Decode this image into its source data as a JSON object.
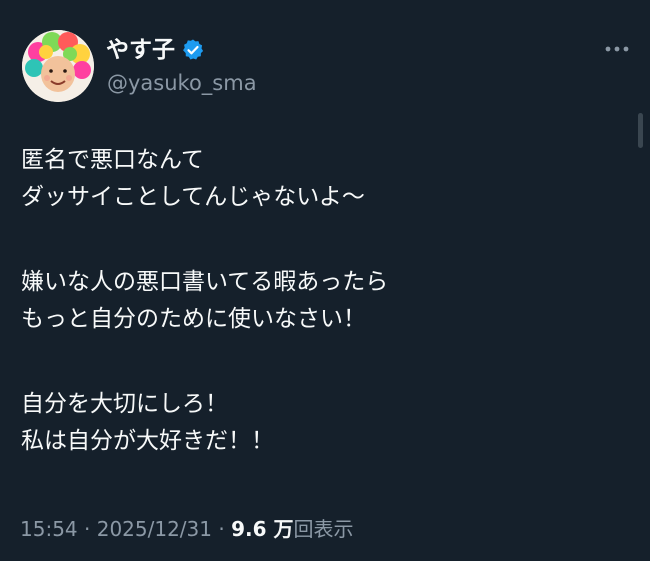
{
  "author": {
    "display_name": "やす子",
    "handle": "@yasuko_sma",
    "verified": true
  },
  "tweet": {
    "paragraphs": [
      [
        "匿名で悪口なんて",
        "ダッサイことしてんじゃないよ〜"
      ],
      [
        "嫌いな人の悪口書いてる暇あったら",
        "もっと自分のために使いなさい！"
      ],
      [
        "自分を大切にしろ！",
        "私は自分が大好きだ！！"
      ]
    ]
  },
  "meta": {
    "time": "15:54",
    "separator": " · ",
    "date": "2025/12/31",
    "views_count": "9.6 万",
    "views_label": "回表示"
  },
  "icons": {
    "verified": "verified-badge-icon",
    "more": "more-options-icon"
  },
  "colors": {
    "background": "#15202b",
    "text": "#f7f9f9",
    "secondary_text": "#8b98a5",
    "verified": "#1d9bf0"
  }
}
